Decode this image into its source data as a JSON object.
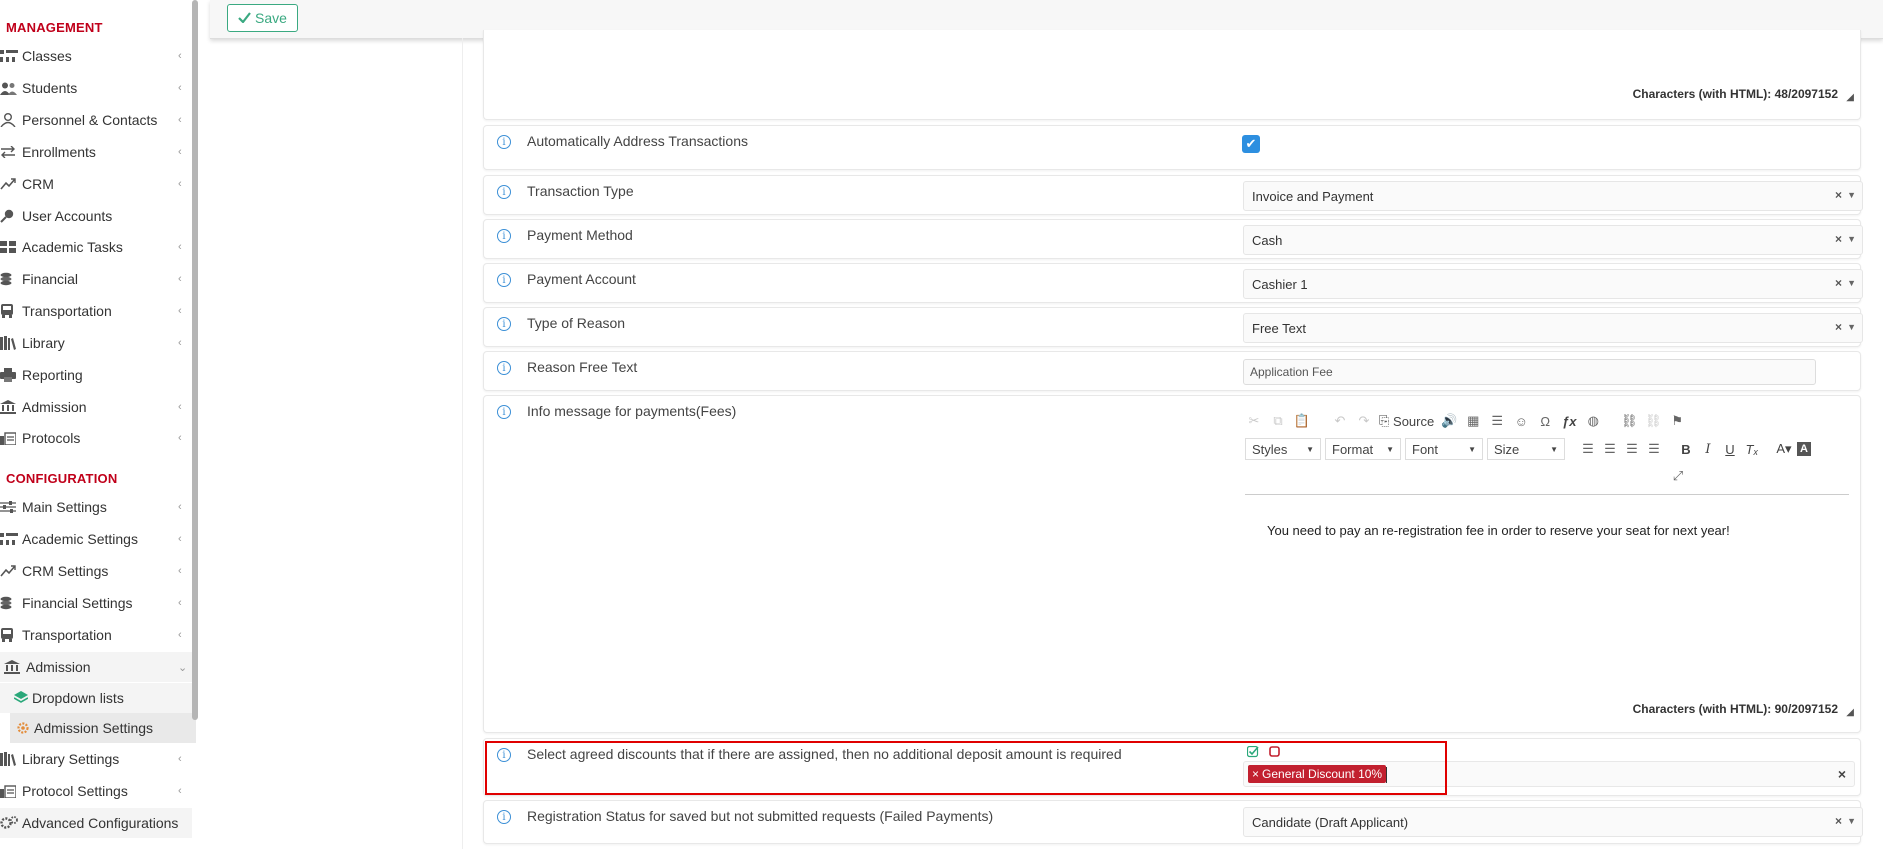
{
  "sidebar": {
    "management_heading": "MANAGEMENT",
    "configuration_heading": "CONFIGURATION",
    "management_items": [
      {
        "label": "Classes",
        "icon": "classes-icon"
      },
      {
        "label": "Students",
        "icon": "students-icon"
      },
      {
        "label": "Personnel & Contacts",
        "icon": "person-icon"
      },
      {
        "label": "Enrollments",
        "icon": "arrows-icon"
      },
      {
        "label": "CRM",
        "icon": "crm-icon"
      },
      {
        "label": "User Accounts",
        "icon": "key-icon"
      },
      {
        "label": "Academic Tasks",
        "icon": "grid-icon"
      },
      {
        "label": "Financial",
        "icon": "coins-icon"
      },
      {
        "label": "Transportation",
        "icon": "bus-icon"
      },
      {
        "label": "Library",
        "icon": "books-icon"
      },
      {
        "label": "Reporting",
        "icon": "printer-icon"
      },
      {
        "label": "Admission",
        "icon": "bank-icon"
      },
      {
        "label": "Protocols",
        "icon": "protocol-icon"
      }
    ],
    "configuration_items": [
      {
        "label": "Main Settings",
        "icon": "sliders-icon"
      },
      {
        "label": "Academic Settings",
        "icon": "classes-icon"
      },
      {
        "label": "CRM Settings",
        "icon": "crm-icon"
      },
      {
        "label": "Financial Settings",
        "icon": "coins-icon"
      },
      {
        "label": "Transportation",
        "icon": "bus-icon"
      },
      {
        "label": "Admission",
        "icon": "bank-icon"
      },
      {
        "label": "Dropdown lists",
        "icon": "layers-icon"
      },
      {
        "label": "Admission Settings",
        "icon": "gear-icon"
      },
      {
        "label": "Library Settings",
        "icon": "books-icon"
      },
      {
        "label": "Protocol Settings",
        "icon": "protocol-icon"
      },
      {
        "label": "Advanced Configurations",
        "icon": "gears-icon"
      }
    ]
  },
  "toolbar": {
    "save_label": "Save"
  },
  "top_editor": {
    "chars": "Characters (with HTML): 48/2097152"
  },
  "fields": {
    "auto_address": {
      "label": "Automatically Address Transactions",
      "checked": true
    },
    "transaction_type": {
      "label": "Transaction Type",
      "value": "Invoice and Payment"
    },
    "payment_method": {
      "label": "Payment Method",
      "value": "Cash"
    },
    "payment_account": {
      "label": "Payment Account",
      "value": "Cashier 1"
    },
    "reason_type": {
      "label": "Type of Reason",
      "value": "Free Text"
    },
    "reason_text": {
      "label": "Reason Free Text",
      "value": "Application Fee"
    },
    "info_message": {
      "label": "Info message for payments(Fees)",
      "source_label": "Source",
      "styles_label": "Styles",
      "format_label": "Format",
      "font_label": "Font",
      "size_label": "Size",
      "content": "You need to pay an re-registration fee in order to reserve your seat for next year!",
      "chars": "Characters (with HTML): 90/2097152"
    },
    "discounts": {
      "label": "Select agreed discounts that if there are assigned, then no additional deposit amount is required",
      "tag": "General Discount 10%",
      "tag_remove": "×",
      "clear": "×"
    },
    "registration_status": {
      "label": "Registration Status for saved but not submitted requests (Failed Payments)",
      "value": "Candidate (Draft Applicant)"
    }
  },
  "colors": {
    "accent_red": "#c0001a",
    "save_green": "#3aa981",
    "checkbox_blue": "#2d8fe0",
    "tag_red": "#c2202f",
    "highlight": "#e00000"
  }
}
